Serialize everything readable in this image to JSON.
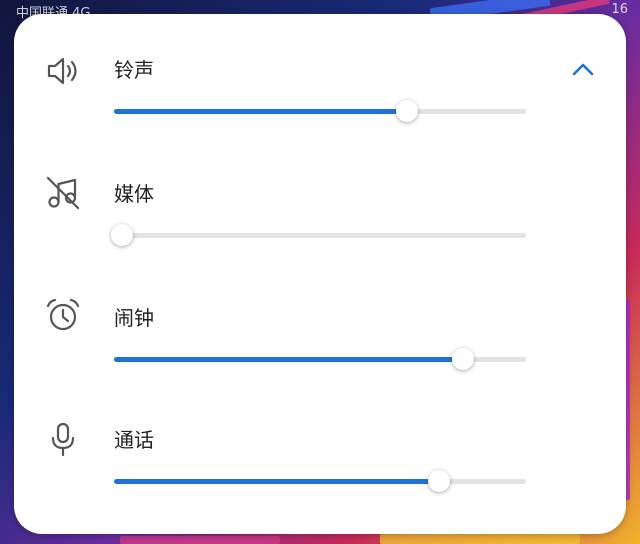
{
  "statusbar": {
    "left_text": "中国联通 4G",
    "right_text": "16"
  },
  "panel": {
    "collapse_icon": "chevron-up-icon",
    "accent_color": "#1f72d6",
    "rows": [
      {
        "label": "铃声",
        "icon": "speaker-icon",
        "level": 0.71
      },
      {
        "label": "媒体",
        "icon": "music-muted-icon",
        "level": 0.02
      },
      {
        "label": "闹钟",
        "icon": "alarm-clock-icon",
        "level": 0.846
      },
      {
        "label": "通话",
        "icon": "microphone-icon",
        "level": 0.79
      }
    ]
  }
}
